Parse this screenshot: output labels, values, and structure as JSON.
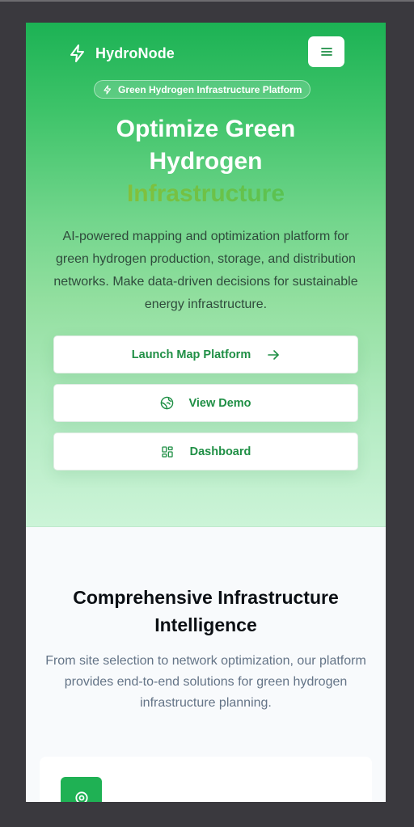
{
  "brand": {
    "name": "HydroNode",
    "logo_icon": "lightning-bolt-icon"
  },
  "header": {
    "menu_icon": "hamburger-menu-icon"
  },
  "hero": {
    "badge": "Green Hydrogen Infrastructure Platform",
    "title_line1": "Optimize Green",
    "title_line2": "Hydrogen",
    "title_accent": "Infrastructure",
    "lead": "AI-powered mapping and optimization platform for green hydrogen production, storage, and distribution networks. Make data-driven decisions for sustainable energy infrastructure.",
    "buttons": [
      {
        "label": "Launch Map Platform",
        "icon": "arrow-right-icon"
      },
      {
        "label": "View Demo",
        "icon": "globe-icon"
      },
      {
        "label": "Dashboard",
        "icon": "dashboard-grid-icon"
      }
    ]
  },
  "features": {
    "title": "Comprehensive Infrastructure Intelligence",
    "subtitle": "From site selection to network optimization, our platform provides end-to-end solutions for green hydrogen infrastructure planning.",
    "first_card_icon": "target-pin-icon"
  },
  "colors": {
    "brand_green": "#1fb154",
    "button_text": "#1f8f45",
    "accent_gradient_start": "#9fbf2c"
  }
}
